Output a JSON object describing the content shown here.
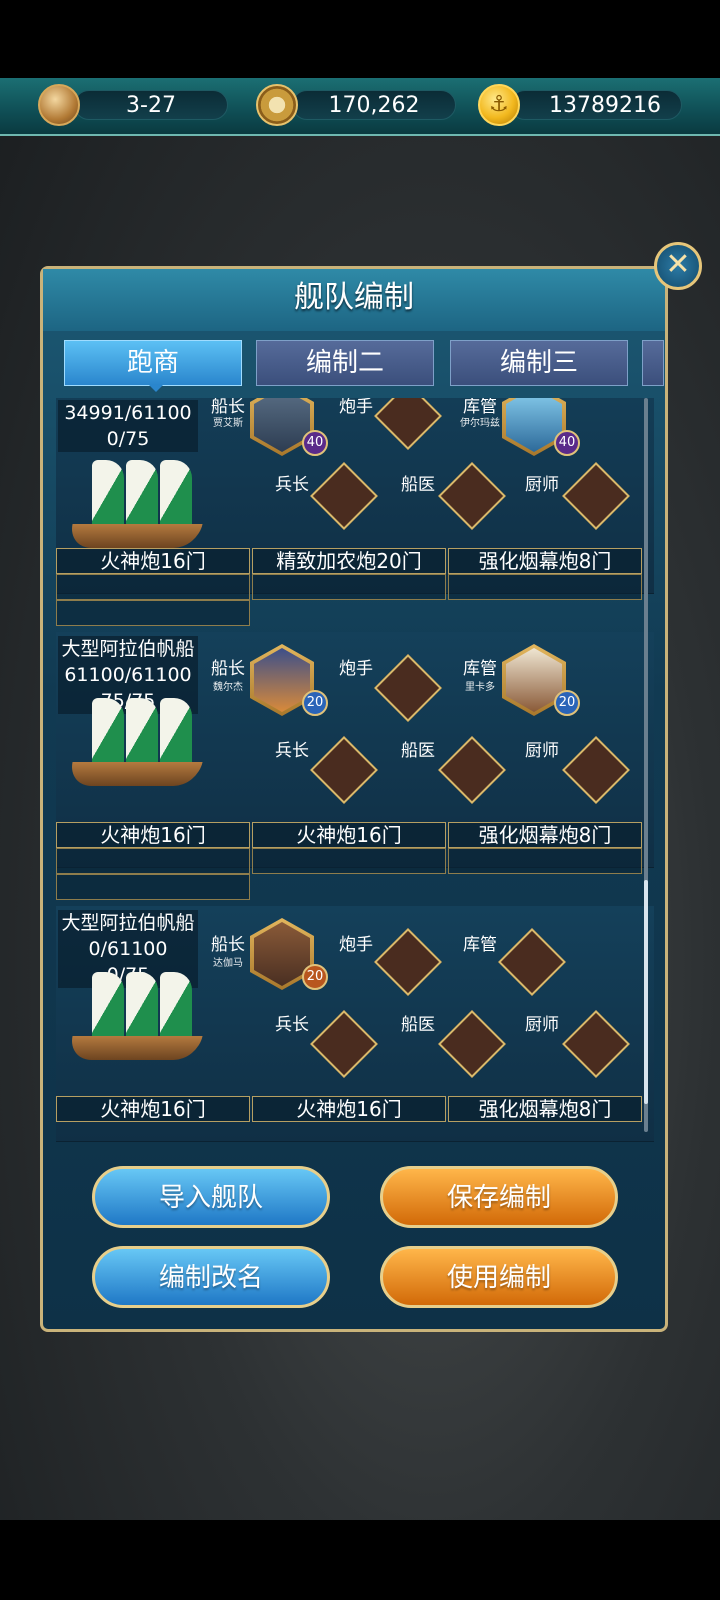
{
  "resources": {
    "stage": "3-27",
    "compass_value": "170,262",
    "gold": "13789216",
    "icons": [
      "hourglass-icon",
      "compass-icon",
      "anchor-coin-icon"
    ]
  },
  "dialog": {
    "title": "舰队编制",
    "tabs": [
      "跑商",
      "编制二",
      "编制三"
    ]
  },
  "slots": {
    "captain": "船长",
    "gunner": "炮手",
    "quartermaster": "库管",
    "sergeant": "兵长",
    "doctor": "船医",
    "cook": "厨师"
  },
  "ships": [
    {
      "durability": "34991/61100",
      "crew": "0/75",
      "captain_name": "贾艾斯",
      "captain_level": "40",
      "quartermaster_name": "伊尔玛兹",
      "quartermaster_level": "40",
      "guns": [
        "火神炮16门",
        "精致加农炮20门",
        "强化烟幕炮8门"
      ]
    },
    {
      "name": "大型阿拉伯帆船",
      "durability": "61100/61100",
      "crew": "75/75",
      "captain_name": "魏尔杰",
      "captain_level": "20",
      "quartermaster_name": "里卡多",
      "quartermaster_level": "20",
      "guns": [
        "火神炮16门",
        "火神炮16门",
        "强化烟幕炮8门"
      ]
    },
    {
      "name": "大型阿拉伯帆船",
      "durability": "0/61100",
      "crew": "0/75",
      "captain_name": "达伽马",
      "captain_level": "20",
      "guns": [
        "火神炮16门",
        "火神炮16门",
        "强化烟幕炮8门"
      ]
    }
  ],
  "buttons": {
    "import_fleet": "导入舰队",
    "save_formation": "保存编制",
    "rename_formation": "编制改名",
    "use_formation": "使用编制"
  }
}
